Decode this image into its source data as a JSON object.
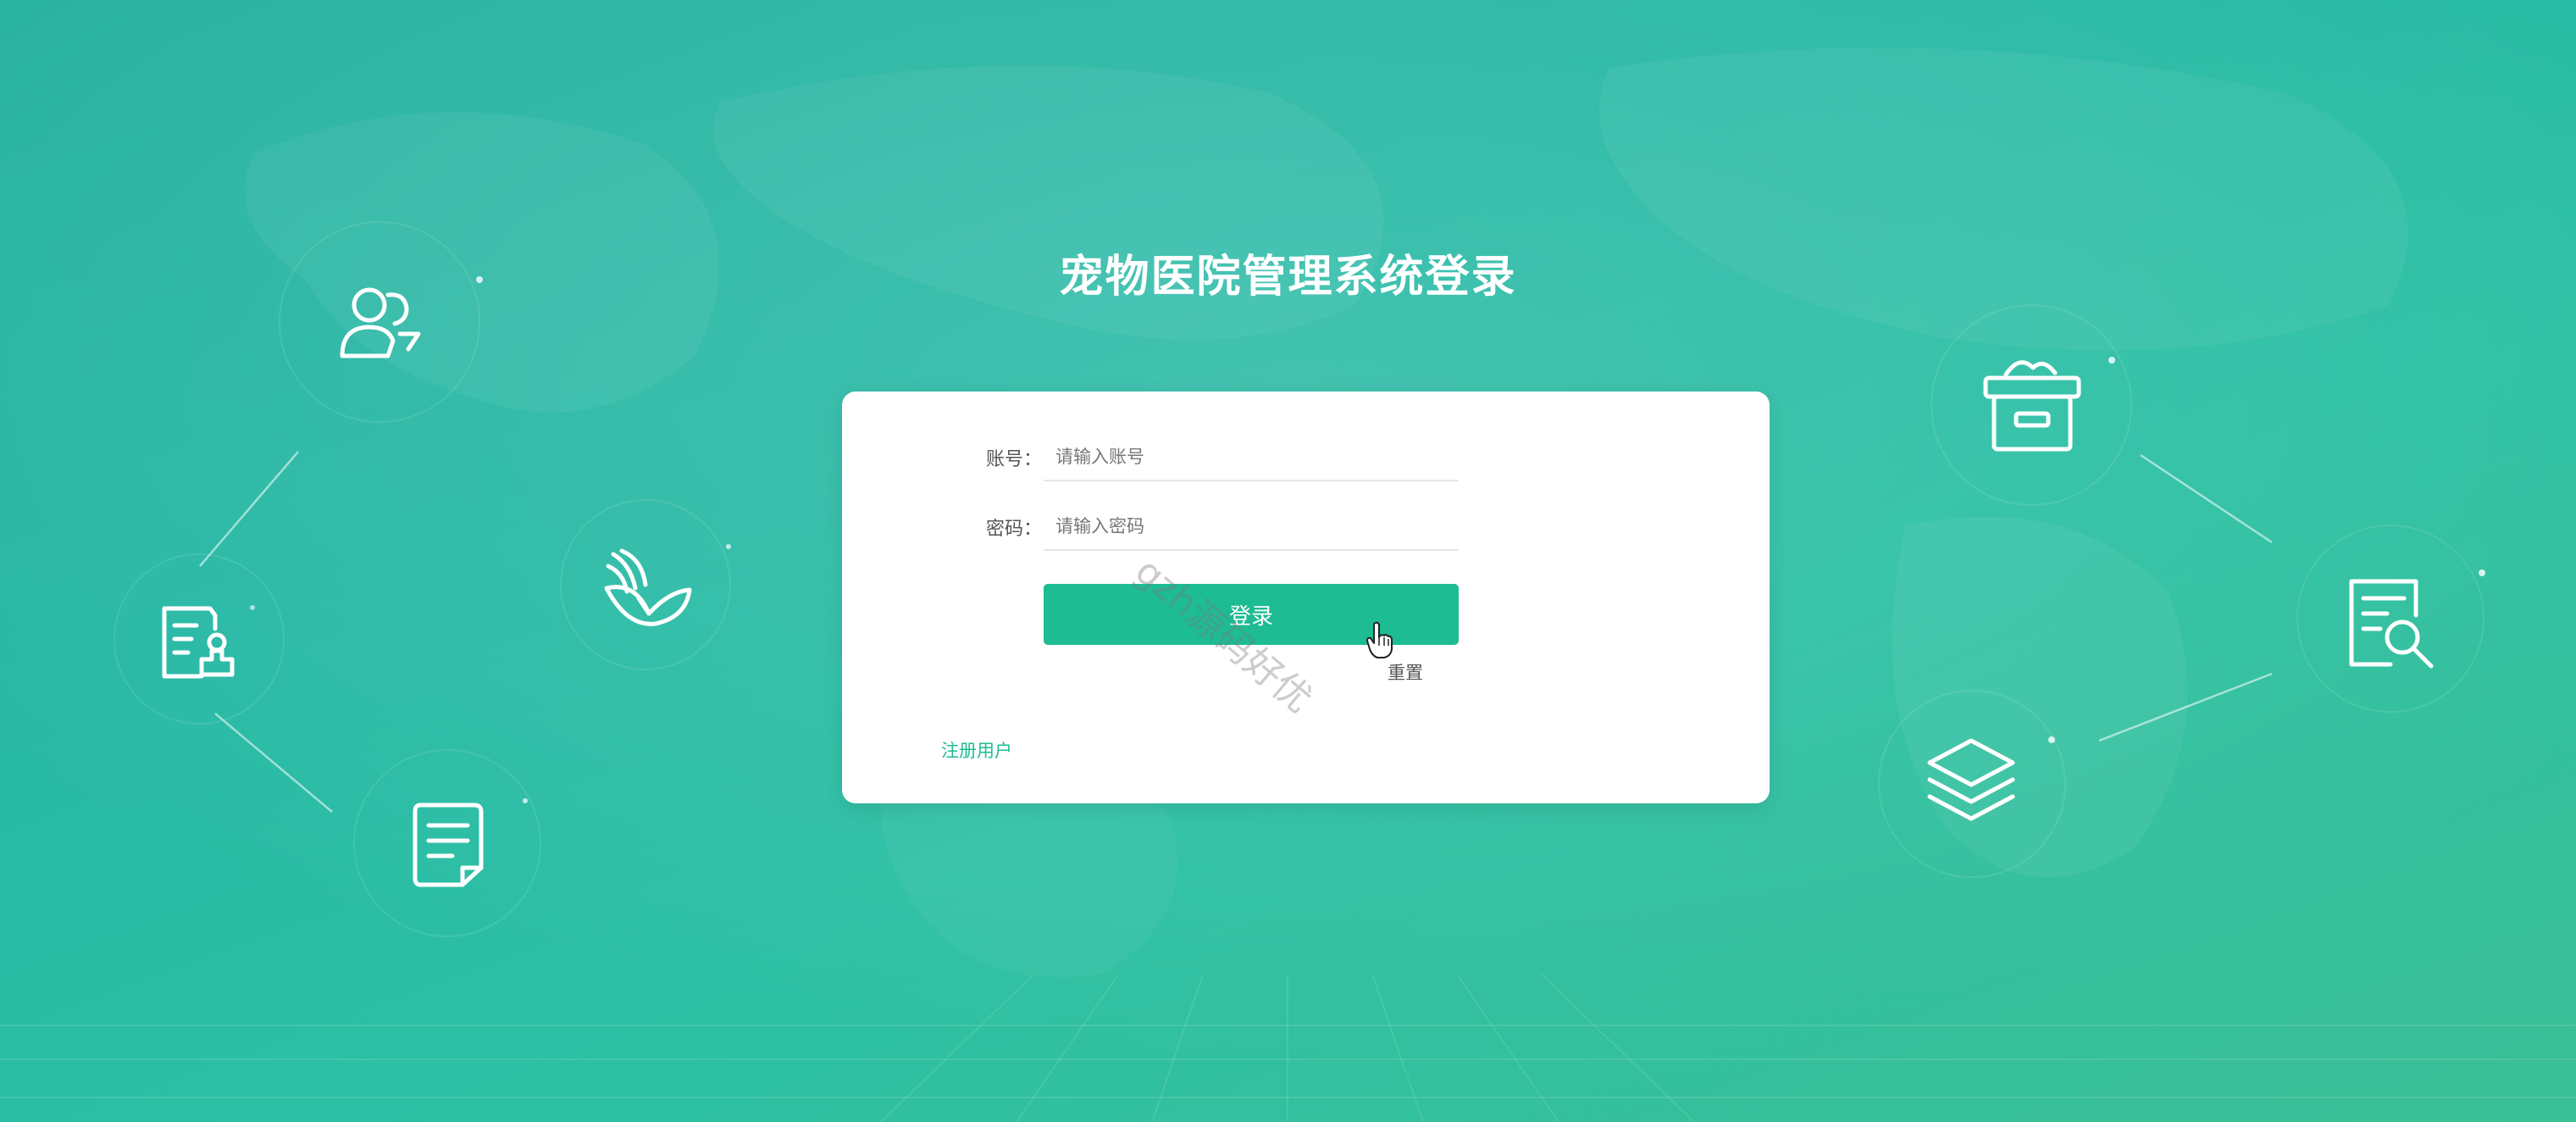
{
  "page": {
    "title": "宠物医院管理系统登录"
  },
  "form": {
    "account_label": "账号：",
    "account_placeholder": "请输入账号",
    "password_label": "密码：",
    "password_placeholder": "请输入密码",
    "login_button": "登录",
    "reset_link": "重置",
    "register_link": "注册用户"
  },
  "watermark": "gzh源码好优",
  "colors": {
    "accent": "#1dbc93",
    "background": "#2bb9a4"
  },
  "icons": {
    "left": [
      "users-icon",
      "certificate-stamp-icon",
      "document-icon",
      "leaf-book-icon"
    ],
    "right": [
      "archive-box-icon",
      "document-search-icon",
      "layers-icon"
    ]
  }
}
